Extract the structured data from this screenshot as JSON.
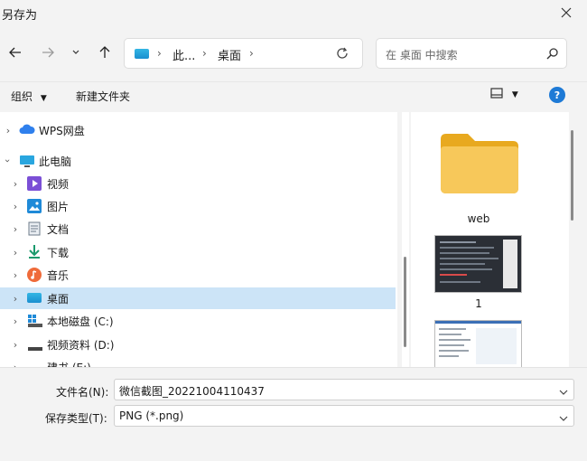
{
  "window": {
    "title": "另存为"
  },
  "nav": {
    "address": {
      "crumbs": [
        "此...",
        "桌面"
      ]
    },
    "search": {
      "placeholder": "在 桌面 中搜索"
    }
  },
  "toolbar": {
    "organize": "组织",
    "new_folder": "新建文件夹",
    "help": "?"
  },
  "tree": [
    {
      "label": "WPS网盘",
      "icon": "cloud-icon",
      "expanded": false
    },
    {
      "label": "此电脑",
      "icon": "computer-icon",
      "expanded": true
    },
    {
      "label": "视频",
      "icon": "video-icon"
    },
    {
      "label": "图片",
      "icon": "picture-icon"
    },
    {
      "label": "文档",
      "icon": "document-icon"
    },
    {
      "label": "下载",
      "icon": "download-icon"
    },
    {
      "label": "音乐",
      "icon": "music-icon"
    },
    {
      "label": "桌面",
      "icon": "desktop-icon",
      "selected": true
    },
    {
      "label": "本地磁盘 (C:)",
      "icon": "drive-icon"
    },
    {
      "label": "视频资料 (D:)",
      "icon": "drive-icon"
    },
    {
      "label": "建书 (E:)",
      "icon": "drive-icon"
    }
  ],
  "files": [
    {
      "name": "web",
      "type": "folder"
    },
    {
      "name": "1",
      "type": "image"
    },
    {
      "name": "",
      "type": "image"
    }
  ],
  "footer": {
    "filename_label": "文件名(N):",
    "filename_value": "微信截图_20221004110437",
    "filetype_label": "保存类型(T):",
    "filetype_value": "PNG (*.png)"
  },
  "colors": {
    "accent": "#1e7ad6",
    "selection": "#cce4f7",
    "folder": "#f5c542"
  }
}
